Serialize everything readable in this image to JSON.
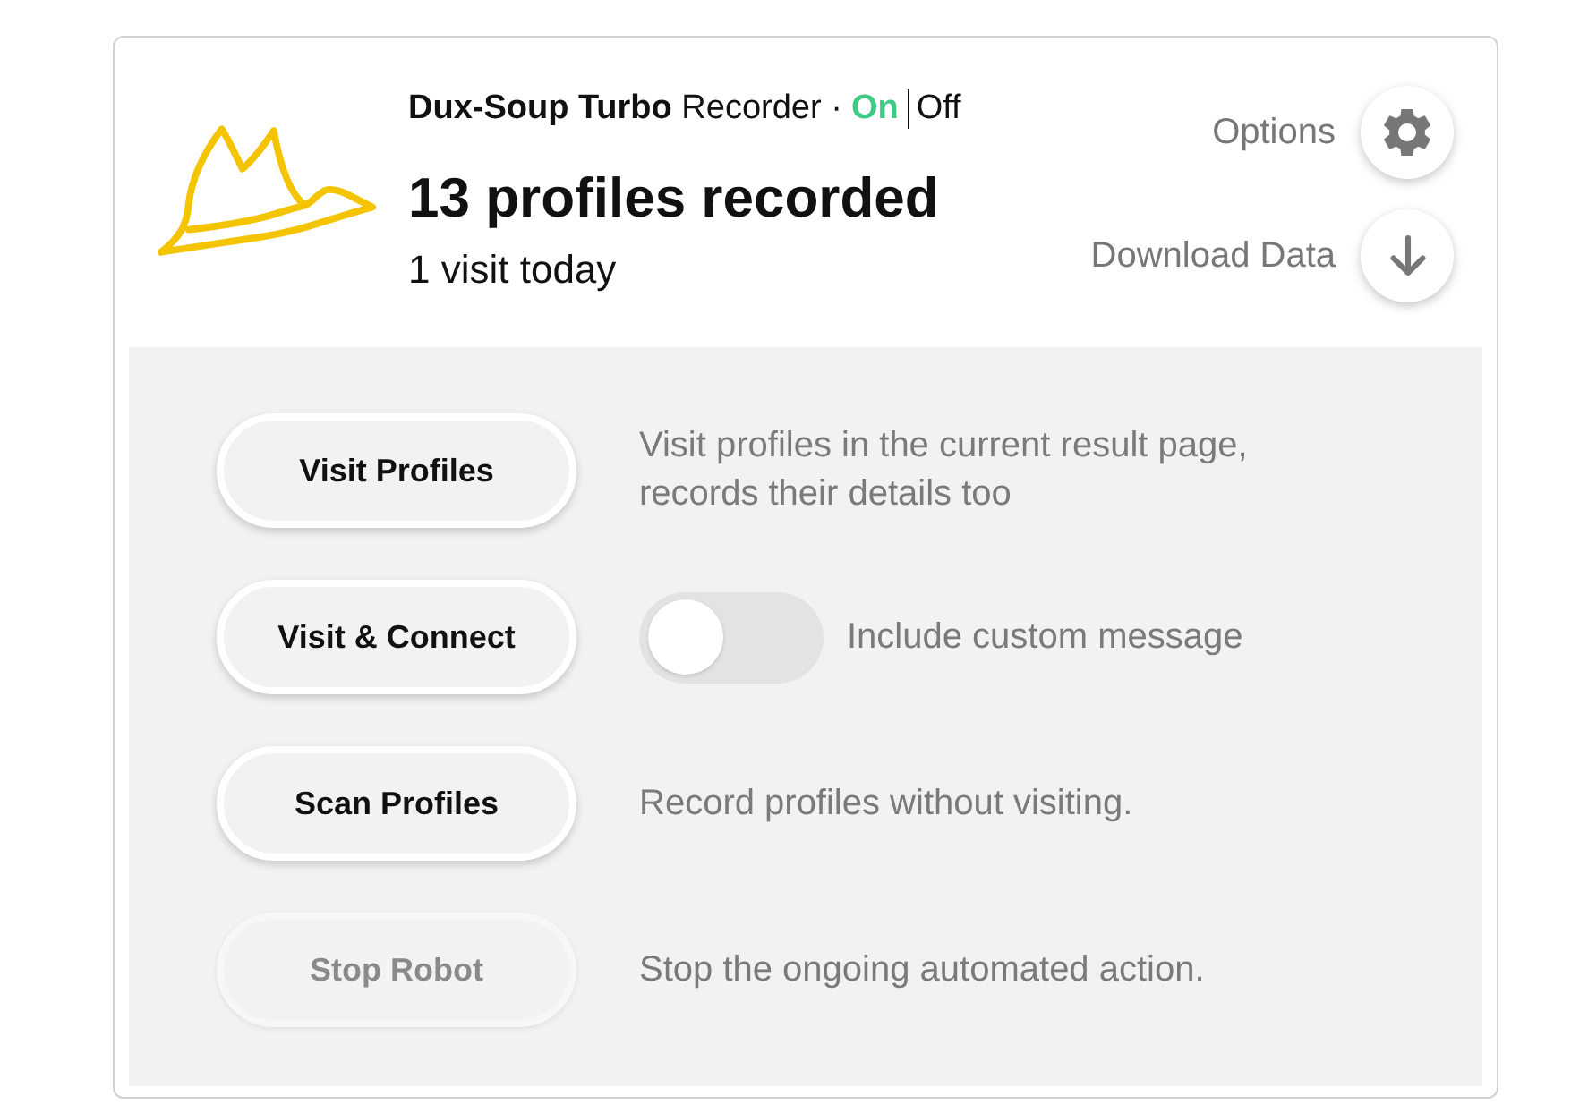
{
  "header": {
    "title": "**Dux-Soup Turbo** Recorder ·",
    "modes": [
      {
        "label": "On",
        "selected": true
      },
      {
        "label": "Off",
        "selected": false
      }
    ],
    "count": "13 profiles recorded",
    "visits": "1 visit today"
  },
  "header_actions": [
    {
      "kind": "options",
      "label": "Options"
    },
    {
      "kind": "download",
      "label": "Download Data"
    }
  ],
  "actions": [
    {
      "kind": "text",
      "button": "Visit Profiles",
      "disabled": false,
      "description": "Visit profiles in the current result page, records their details too"
    },
    {
      "kind": "toggle",
      "button": "Visit & Connect",
      "disabled": false,
      "toggle": {
        "on": false,
        "label": "Include custom message"
      }
    },
    {
      "kind": "text",
      "button": "Scan Profiles",
      "disabled": false,
      "description": "Record profiles without visiting."
    },
    {
      "kind": "text",
      "button": "Stop Robot",
      "disabled": true,
      "description": "Stop the ongoing automated action."
    }
  ]
}
